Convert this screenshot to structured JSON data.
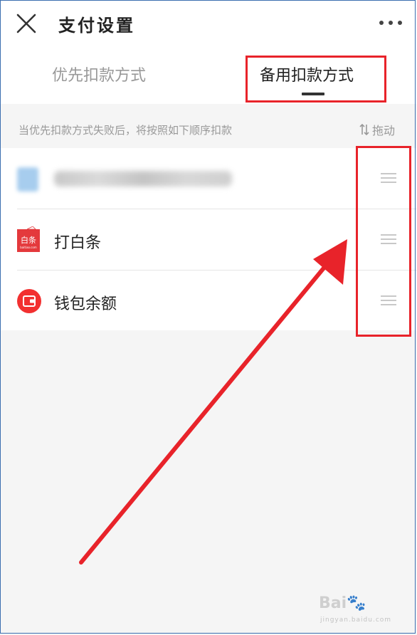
{
  "header": {
    "title": "支付设置",
    "close_icon": "close-icon",
    "more_icon": "more-icon"
  },
  "tabs": [
    {
      "label": "优先扣款方式",
      "active": false
    },
    {
      "label": "备用扣款方式",
      "active": true
    }
  ],
  "hint": {
    "text": "当优先扣款方式失败后，将按照如下顺序扣款",
    "drag_label": "拖动",
    "drag_icon": "sort-icon"
  },
  "payment_methods": [
    {
      "label": "",
      "icon": "blurred-card-icon",
      "blurred": true
    },
    {
      "label": "打白条",
      "icon": "baitiao-icon"
    },
    {
      "label": "钱包余额",
      "icon": "wallet-icon"
    }
  ],
  "icon_texts": {
    "baitiao": "白条",
    "baitiao_domain": "baitiao.com"
  },
  "watermark": {
    "brand": "Bai",
    "site": "jingyan.baidu.com"
  },
  "colors": {
    "annotation_red": "#e8232a",
    "brand_red": "#e4393c",
    "wallet_red": "#f23030"
  }
}
